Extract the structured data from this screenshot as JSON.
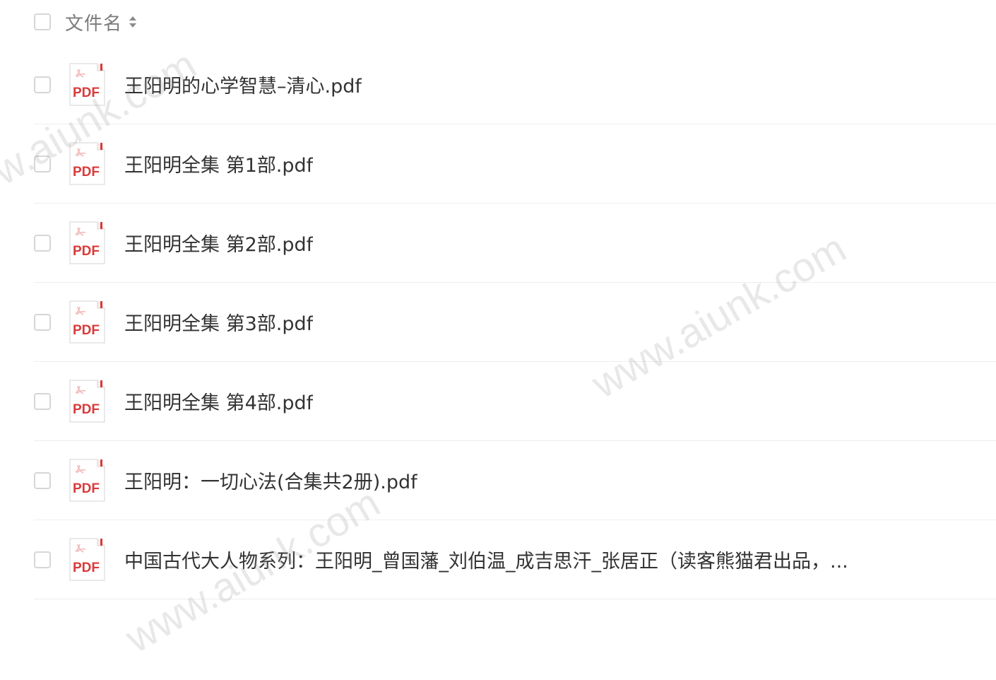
{
  "header": {
    "label": "文件名"
  },
  "files": [
    {
      "name": "王阳明的心学智慧–清心.pdf",
      "icon_text": "PDF"
    },
    {
      "name": "王阳明全集 第1部.pdf",
      "icon_text": "PDF"
    },
    {
      "name": "王阳明全集 第2部.pdf",
      "icon_text": "PDF"
    },
    {
      "name": "王阳明全集 第3部.pdf",
      "icon_text": "PDF"
    },
    {
      "name": "王阳明全集 第4部.pdf",
      "icon_text": "PDF"
    },
    {
      "name": "王阳明：一切心法(合集共2册).pdf",
      "icon_text": "PDF"
    },
    {
      "name": "中国古代大人物系列：王阳明_曾国藩_刘伯温_成吉思汗_张居正（读客熊猫君出品，...",
      "icon_text": "PDF"
    }
  ],
  "watermark": {
    "text": "www.aiunk.com"
  },
  "colors": {
    "pdf_red": "#d93a3a",
    "pdf_light": "#f3b9b9",
    "checkbox_border": "#d6d6d6",
    "divider": "#eeeeee"
  }
}
